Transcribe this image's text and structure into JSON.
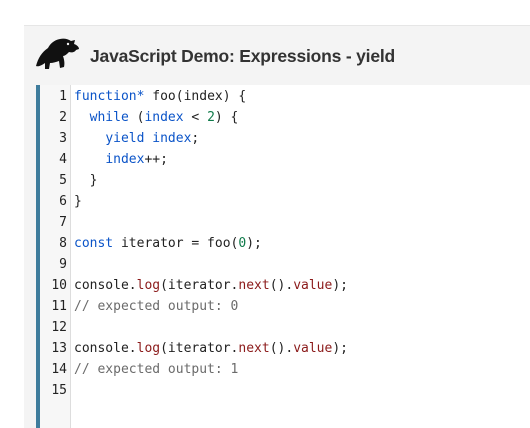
{
  "header": {
    "title": "JavaScript Demo: Expressions - yield",
    "logo_icon": "dinosaur-logo-icon"
  },
  "colors": {
    "editor_accent": "#3e7c9c",
    "keyword": "#0b54c8",
    "number": "#0f7a4a",
    "method": "#8b1a1a",
    "comment": "#6b6b6b"
  },
  "editor": {
    "line_numbers": [
      "1",
      "2",
      "3",
      "4",
      "5",
      "6",
      "7",
      "8",
      "9",
      "10",
      "11",
      "12",
      "13",
      "14",
      "15"
    ],
    "lines": [
      [
        {
          "t": "function*",
          "c": "kw"
        },
        {
          "t": " foo(index) {",
          "c": "pl"
        }
      ],
      [
        {
          "t": "  ",
          "c": "pl"
        },
        {
          "t": "while",
          "c": "kw"
        },
        {
          "t": " (",
          "c": "pl"
        },
        {
          "t": "index",
          "c": "var"
        },
        {
          "t": " < ",
          "c": "pl"
        },
        {
          "t": "2",
          "c": "num"
        },
        {
          "t": ") {",
          "c": "pl"
        }
      ],
      [
        {
          "t": "    ",
          "c": "pl"
        },
        {
          "t": "yield",
          "c": "kw"
        },
        {
          "t": " ",
          "c": "pl"
        },
        {
          "t": "index",
          "c": "var"
        },
        {
          "t": ";",
          "c": "pl"
        }
      ],
      [
        {
          "t": "    ",
          "c": "pl"
        },
        {
          "t": "index",
          "c": "var"
        },
        {
          "t": "++;",
          "c": "pl"
        }
      ],
      [
        {
          "t": "  }",
          "c": "pl"
        }
      ],
      [
        {
          "t": "}",
          "c": "pl"
        }
      ],
      [],
      [
        {
          "t": "const",
          "c": "kw"
        },
        {
          "t": " iterator = foo(",
          "c": "pl"
        },
        {
          "t": "0",
          "c": "num"
        },
        {
          "t": ");",
          "c": "pl"
        }
      ],
      [],
      [
        {
          "t": "console.",
          "c": "pl"
        },
        {
          "t": "log",
          "c": "fn"
        },
        {
          "t": "(iterator.",
          "c": "pl"
        },
        {
          "t": "next",
          "c": "fn"
        },
        {
          "t": "().",
          "c": "pl"
        },
        {
          "t": "value",
          "c": "fn"
        },
        {
          "t": ");",
          "c": "pl"
        }
      ],
      [
        {
          "t": "// expected output: 0",
          "c": "cm"
        }
      ],
      [],
      [
        {
          "t": "console.",
          "c": "pl"
        },
        {
          "t": "log",
          "c": "fn"
        },
        {
          "t": "(iterator.",
          "c": "pl"
        },
        {
          "t": "next",
          "c": "fn"
        },
        {
          "t": "().",
          "c": "pl"
        },
        {
          "t": "value",
          "c": "fn"
        },
        {
          "t": ");",
          "c": "pl"
        }
      ],
      [
        {
          "t": "// expected output: 1",
          "c": "cm"
        }
      ],
      []
    ]
  }
}
